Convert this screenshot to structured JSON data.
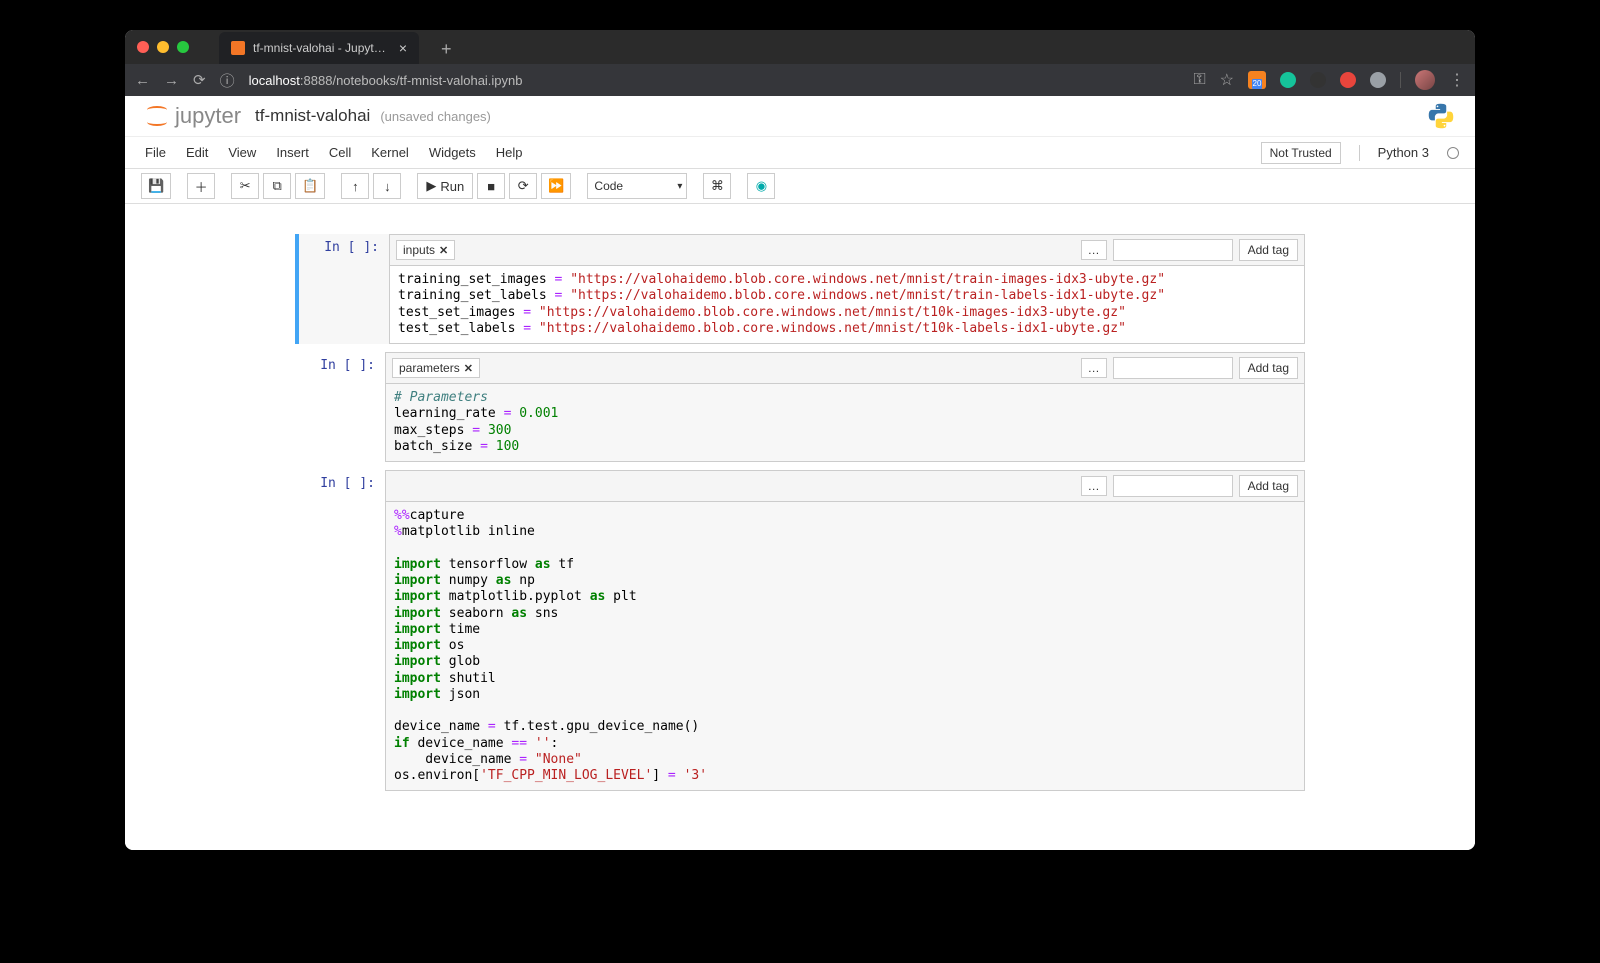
{
  "browser": {
    "tab_title": "tf-mnist-valohai - Jupyter Note",
    "url_host": "localhost",
    "url_port": ":8888",
    "url_path": "/notebooks/tf-mnist-valohai.ipynb",
    "ext_badge": "20"
  },
  "jupyter": {
    "brand": "jupyter",
    "title": "tf-mnist-valohai",
    "status": "(unsaved changes)",
    "menu": [
      "File",
      "Edit",
      "View",
      "Insert",
      "Cell",
      "Kernel",
      "Widgets",
      "Help"
    ],
    "not_trusted": "Not Trusted",
    "kernel": "Python 3",
    "toolbar": {
      "run": "Run",
      "celltype": "Code"
    }
  },
  "cells": [
    {
      "prompt": "In [ ]:",
      "active": true,
      "tags": [
        "inputs"
      ],
      "addtag": "Add tag",
      "code_tokens": [
        [
          [
            "nm",
            "training_set_images"
          ],
          [
            "op",
            " = "
          ],
          [
            "str",
            "\"https://valohaidemo.blob.core.windows.net/mnist/train-images-idx3-ubyte.gz\""
          ]
        ],
        [
          [
            "nm",
            "training_set_labels"
          ],
          [
            "op",
            " = "
          ],
          [
            "str",
            "\"https://valohaidemo.blob.core.windows.net/mnist/train-labels-idx1-ubyte.gz\""
          ]
        ],
        [
          [
            "nm",
            "test_set_images"
          ],
          [
            "op",
            " = "
          ],
          [
            "str",
            "\"https://valohaidemo.blob.core.windows.net/mnist/t10k-images-idx3-ubyte.gz\""
          ]
        ],
        [
          [
            "nm",
            "test_set_labels"
          ],
          [
            "op",
            " = "
          ],
          [
            "str",
            "\"https://valohaidemo.blob.core.windows.net/mnist/t10k-labels-idx1-ubyte.gz\""
          ]
        ]
      ]
    },
    {
      "prompt": "In [ ]:",
      "active": false,
      "tags": [
        "parameters"
      ],
      "addtag": "Add tag",
      "code_tokens": [
        [
          [
            "cm",
            "# Parameters"
          ]
        ],
        [
          [
            "nm",
            "learning_rate"
          ],
          [
            "op",
            " = "
          ],
          [
            "num",
            "0.001"
          ]
        ],
        [
          [
            "nm",
            "max_steps"
          ],
          [
            "op",
            " = "
          ],
          [
            "num",
            "300"
          ]
        ],
        [
          [
            "nm",
            "batch_size"
          ],
          [
            "op",
            " = "
          ],
          [
            "num",
            "100"
          ]
        ]
      ]
    },
    {
      "prompt": "In [ ]:",
      "active": false,
      "tags": [],
      "addtag": "Add tag",
      "code_tokens": [
        [
          [
            "op",
            "%%"
          ],
          [
            "nm",
            "capture"
          ]
        ],
        [
          [
            "op",
            "%"
          ],
          [
            "nm",
            "matplotlib inline"
          ]
        ],
        [],
        [
          [
            "kw",
            "import"
          ],
          [
            "nm",
            " tensorflow "
          ],
          [
            "kw",
            "as"
          ],
          [
            "nm",
            " tf"
          ]
        ],
        [
          [
            "kw",
            "import"
          ],
          [
            "nm",
            " numpy "
          ],
          [
            "kw",
            "as"
          ],
          [
            "nm",
            " np"
          ]
        ],
        [
          [
            "kw",
            "import"
          ],
          [
            "nm",
            " matplotlib.pyplot "
          ],
          [
            "kw",
            "as"
          ],
          [
            "nm",
            " plt"
          ]
        ],
        [
          [
            "kw",
            "import"
          ],
          [
            "nm",
            " seaborn "
          ],
          [
            "kw",
            "as"
          ],
          [
            "nm",
            " sns"
          ]
        ],
        [
          [
            "kw",
            "import"
          ],
          [
            "nm",
            " time"
          ]
        ],
        [
          [
            "kw",
            "import"
          ],
          [
            "nm",
            " os"
          ]
        ],
        [
          [
            "kw",
            "import"
          ],
          [
            "nm",
            " glob"
          ]
        ],
        [
          [
            "kw",
            "import"
          ],
          [
            "nm",
            " shutil"
          ]
        ],
        [
          [
            "kw",
            "import"
          ],
          [
            "nm",
            " json"
          ]
        ],
        [],
        [
          [
            "nm",
            "device_name"
          ],
          [
            "op",
            " = "
          ],
          [
            "nm",
            "tf.test.gpu_device_name()"
          ]
        ],
        [
          [
            "kw",
            "if"
          ],
          [
            "nm",
            " device_name "
          ],
          [
            "op",
            "=="
          ],
          [
            "nm",
            " "
          ],
          [
            "str",
            "''"
          ],
          [
            "nm",
            ":"
          ]
        ],
        [
          [
            "nm",
            "    device_name"
          ],
          [
            "op",
            " = "
          ],
          [
            "str",
            "\"None\""
          ]
        ],
        [
          [
            "nm",
            "os.environ["
          ],
          [
            "str",
            "'TF_CPP_MIN_LOG_LEVEL'"
          ],
          [
            "nm",
            "]"
          ],
          [
            "op",
            " = "
          ],
          [
            "str",
            "'3'"
          ]
        ]
      ]
    }
  ]
}
